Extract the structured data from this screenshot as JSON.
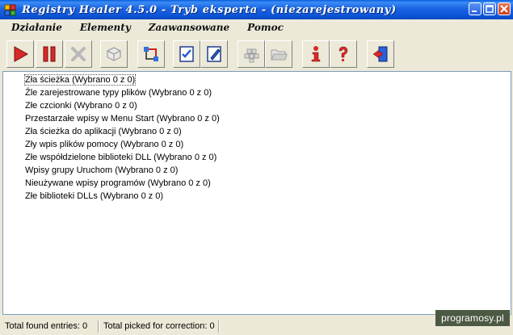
{
  "window": {
    "title": "Registry Healer 4.5.0 - Tryb eksperta -  (niezarejestrowany)"
  },
  "menu": [
    "Działanie",
    "Elementy",
    "Zaawansowane",
    "Pomoc"
  ],
  "toolbar_icons": [
    "play-icon",
    "pause-icon",
    "cancel-icon",
    "registry-cube-icon",
    "fix-icon",
    "edit-check-icon",
    "edit-pen-icon",
    "backup-grid-icon",
    "folder-open-icon",
    "info-icon",
    "help-icon",
    "exit-icon"
  ],
  "list": {
    "items": [
      "Zła ścieżka (Wybrano 0 z 0)",
      "Źle zarejestrowane typy plików (Wybrano 0 z 0)",
      "Złe czcionki (Wybrano 0 z 0)",
      "Przestarzałe wpisy w Menu Start (Wybrano 0 z 0)",
      "Zła ścieżka do aplikacji (Wybrano 0 z 0)",
      "Zły wpis plików pomocy (Wybrano 0 z 0)",
      "Złe współdzielone biblioteki DLL (Wybrano 0 z 0)",
      "Wpisy grupy Uruchom (Wybrano 0 z 0)",
      "Nieużywane wpisy programów (Wybrano 0 z 0)",
      "Złe biblioteki DLLs (Wybrano 0 z 0)"
    ]
  },
  "status": {
    "found": "Total found entries: 0",
    "picked": "Total picked for correction: 0"
  },
  "watermark": "programosy.pl",
  "colors": {
    "titlebar": "#0d55d6",
    "play": "#d62a2a",
    "list_border": "#7f9db9",
    "watermark_bg": "#4d5a43"
  }
}
